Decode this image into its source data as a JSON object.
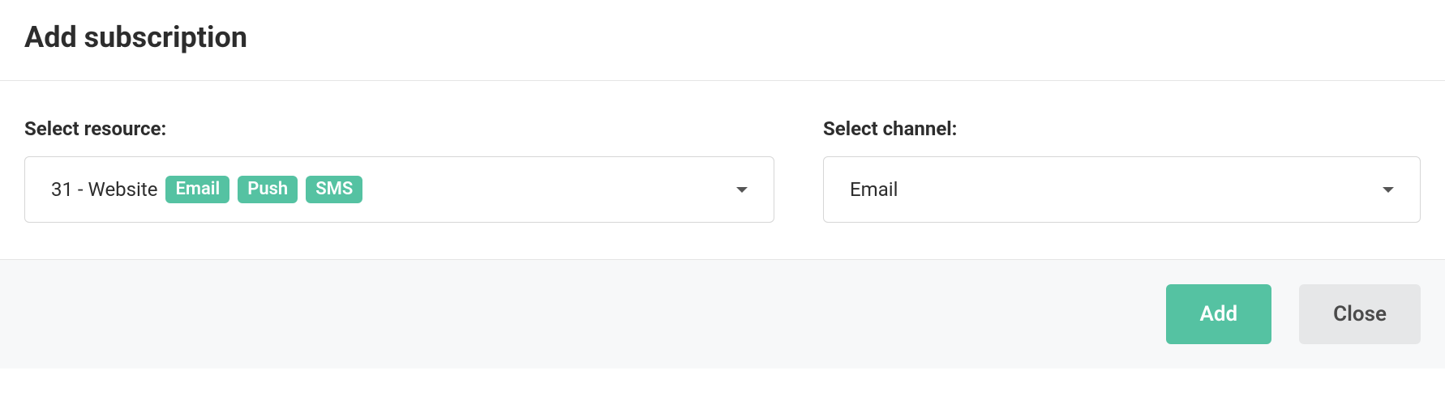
{
  "dialog": {
    "title": "Add subscription"
  },
  "resource": {
    "label": "Select resource:",
    "selected_text": "31 - Website",
    "badges": [
      "Email",
      "Push",
      "SMS"
    ]
  },
  "channel": {
    "label": "Select channel:",
    "selected_text": "Email"
  },
  "footer": {
    "add_label": "Add",
    "close_label": "Close"
  }
}
